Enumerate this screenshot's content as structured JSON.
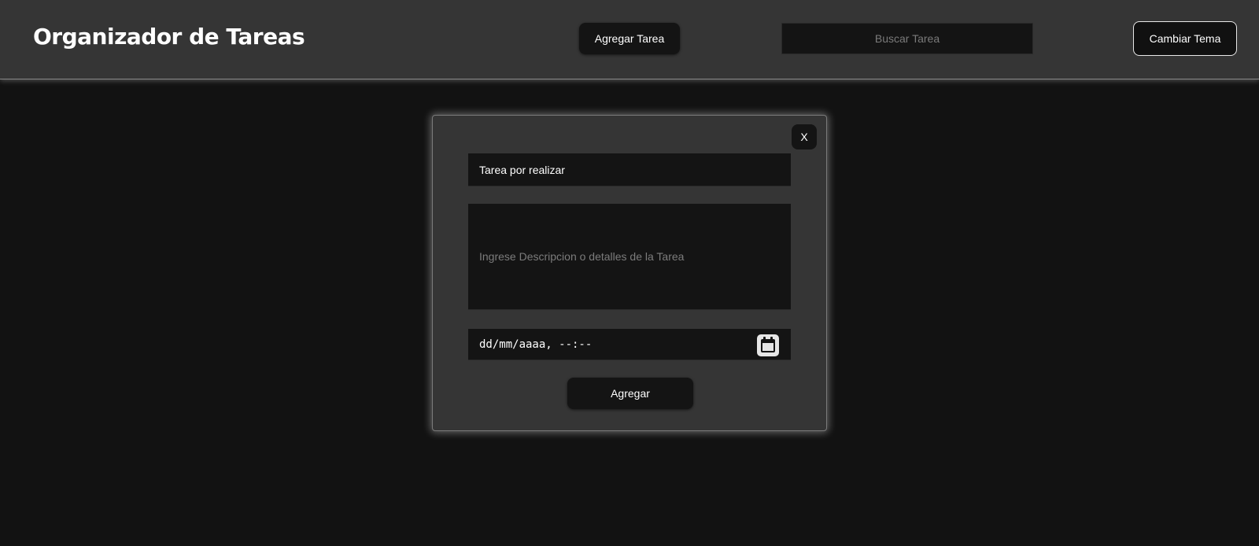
{
  "header": {
    "title": "Organizador de Tareas",
    "add_task_label": "Agregar Tarea",
    "search_placeholder": "Buscar Tarea",
    "theme_label": "Cambiar Tema"
  },
  "modal": {
    "close_label": "X",
    "task_value": "Tarea por realizar",
    "description_placeholder": "Ingrese Descripcion o detalles de la Tarea",
    "datetime_placeholder": "dd/mm/aaaa, --:--",
    "submit_label": "Agregar",
    "calendar_icon": "calendar-icon"
  },
  "colors": {
    "background": "#121212",
    "header_bg": "#353535",
    "modal_bg": "#353535",
    "field_bg": "#141414",
    "text": "#ffffff"
  }
}
